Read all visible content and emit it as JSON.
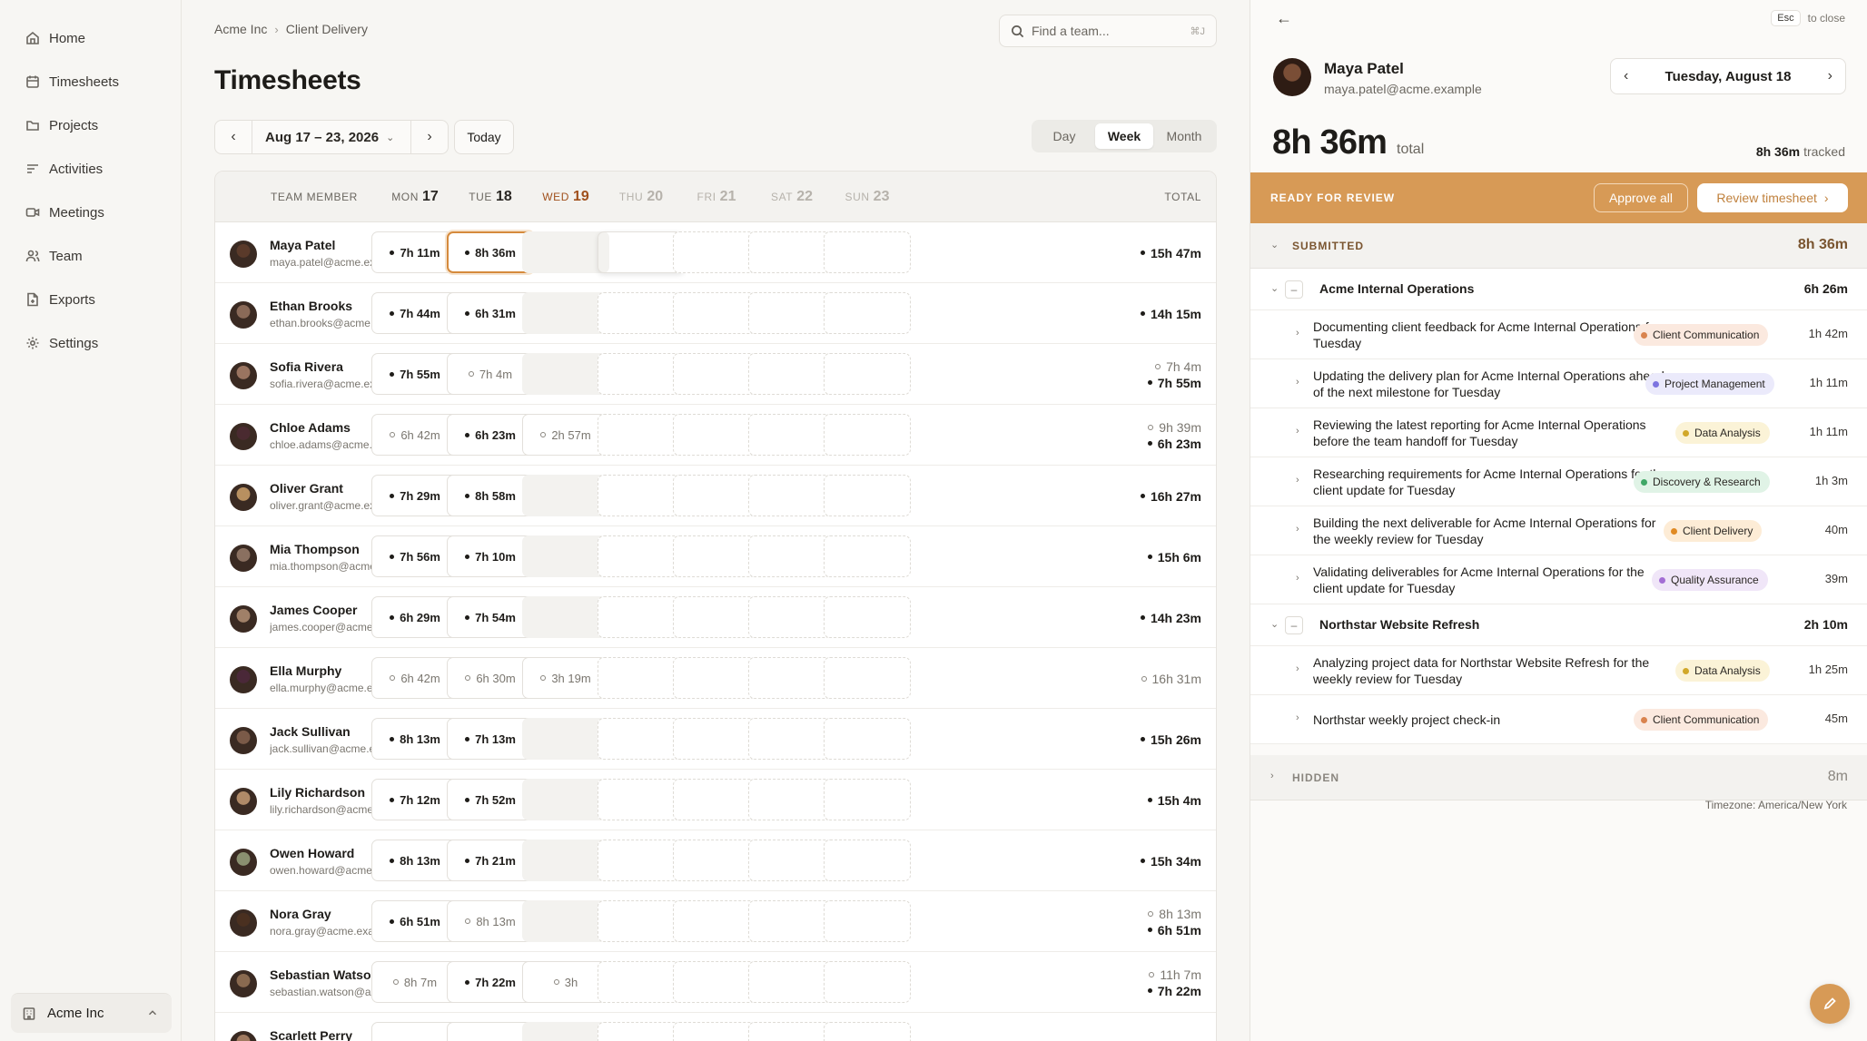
{
  "sidebar": {
    "items": [
      {
        "label": "Home",
        "icon": "home-icon"
      },
      {
        "label": "Timesheets",
        "icon": "calendar-icon"
      },
      {
        "label": "Projects",
        "icon": "folder-icon"
      },
      {
        "label": "Activities",
        "icon": "list-icon"
      },
      {
        "label": "Meetings",
        "icon": "video-icon"
      },
      {
        "label": "Team",
        "icon": "users-icon"
      },
      {
        "label": "Exports",
        "icon": "file-export-icon"
      },
      {
        "label": "Settings",
        "icon": "gear-icon"
      }
    ],
    "org": "Acme Inc"
  },
  "header": {
    "breadcrumb": [
      "Acme Inc",
      "Client Delivery"
    ],
    "search_placeholder": "Find a team...",
    "search_shortcut": "⌘J",
    "title": "Timesheets",
    "date_range": "Aug 17 – 23, 2026",
    "today": "Today",
    "views": [
      "Day",
      "Week",
      "Month"
    ],
    "active_view": "Week"
  },
  "table": {
    "member_header": "TEAM MEMBER",
    "total_header": "TOTAL",
    "days": [
      {
        "dow": "MON",
        "num": "17"
      },
      {
        "dow": "TUE",
        "num": "18"
      },
      {
        "dow": "WED",
        "num": "19"
      },
      {
        "dow": "THU",
        "num": "20"
      },
      {
        "dow": "FRI",
        "num": "21"
      },
      {
        "dow": "SAT",
        "num": "22"
      },
      {
        "dow": "SUN",
        "num": "23"
      }
    ],
    "rows": [
      {
        "name": "Maya Patel",
        "email": "maya.patel@acme.example",
        "avatar": "#5a3a2a",
        "mon": "7h 11m",
        "mon_s": "f",
        "tue": "8h 36m",
        "tue_s": "f",
        "wed": "",
        "wed_s": "blank",
        "total_pending": "",
        "total": "15h 47m"
      },
      {
        "name": "Ethan Brooks",
        "email": "ethan.brooks@acme.example",
        "avatar": "#8a6a58",
        "mon": "7h 44m",
        "mon_s": "f",
        "tue": "6h 31m",
        "tue_s": "f",
        "wed": "",
        "wed_s": "blank",
        "total_pending": "",
        "total": "14h 15m"
      },
      {
        "name": "Sofia Rivera",
        "email": "sofia.rivera@acme.example",
        "avatar": "#9a7460",
        "mon": "7h 55m",
        "mon_s": "f",
        "tue": "7h 4m",
        "tue_s": "p",
        "wed": "",
        "wed_s": "blank",
        "total_pending": "7h 4m",
        "total": "7h 55m"
      },
      {
        "name": "Chloe Adams",
        "email": "chloe.adams@acme.example",
        "avatar": "#4a2a30",
        "mon": "6h 42m",
        "mon_s": "p",
        "tue": "6h 23m",
        "tue_s": "f",
        "wed": "2h 57m",
        "wed_s": "p",
        "total_pending": "9h 39m",
        "total": "6h 23m"
      },
      {
        "name": "Oliver Grant",
        "email": "oliver.grant@acme.example",
        "avatar": "#b89060",
        "mon": "7h 29m",
        "mon_s": "f",
        "tue": "8h 58m",
        "tue_s": "f",
        "wed": "",
        "wed_s": "blank",
        "total_pending": "",
        "total": "16h 27m"
      },
      {
        "name": "Mia Thompson",
        "email": "mia.thompson@acme.example",
        "avatar": "#8a7060",
        "mon": "7h 56m",
        "mon_s": "f",
        "tue": "7h 10m",
        "tue_s": "f",
        "wed": "",
        "wed_s": "blank",
        "total_pending": "",
        "total": "15h 6m"
      },
      {
        "name": "James Cooper",
        "email": "james.cooper@acme.example",
        "avatar": "#a08068",
        "mon": "6h 29m",
        "mon_s": "f",
        "tue": "7h 54m",
        "tue_s": "f",
        "wed": "",
        "wed_s": "blank",
        "total_pending": "",
        "total": "14h 23m"
      },
      {
        "name": "Ella Murphy",
        "email": "ella.murphy@acme.example",
        "avatar": "#4a2838",
        "mon": "6h 42m",
        "mon_s": "p",
        "tue": "6h 30m",
        "tue_s": "p",
        "wed": "3h 19m",
        "wed_s": "p",
        "total_pending": "16h 31m",
        "total": ""
      },
      {
        "name": "Jack Sullivan",
        "email": "jack.sullivan@acme.example",
        "avatar": "#7a5a48",
        "mon": "8h 13m",
        "mon_s": "f",
        "tue": "7h 13m",
        "tue_s": "f",
        "wed": "",
        "wed_s": "blank",
        "total_pending": "",
        "total": "15h 26m"
      },
      {
        "name": "Lily Richardson",
        "email": "lily.richardson@acme.example",
        "avatar": "#b08a68",
        "mon": "7h 12m",
        "mon_s": "f",
        "tue": "7h 52m",
        "tue_s": "f",
        "wed": "",
        "wed_s": "blank",
        "total_pending": "",
        "total": "15h 4m"
      },
      {
        "name": "Owen Howard",
        "email": "owen.howard@acme.example",
        "avatar": "#8a9070",
        "mon": "8h 13m",
        "mon_s": "f",
        "tue": "7h 21m",
        "tue_s": "f",
        "wed": "",
        "wed_s": "blank",
        "total_pending": "",
        "total": "15h 34m"
      },
      {
        "name": "Nora Gray",
        "email": "nora.gray@acme.example",
        "avatar": "#4a3020",
        "mon": "6h 51m",
        "mon_s": "f",
        "tue": "8h 13m",
        "tue_s": "p",
        "wed": "",
        "wed_s": "blank",
        "total_pending": "8h 13m",
        "total": "6h 51m"
      },
      {
        "name": "Sebastian Watson",
        "email": "sebastian.watson@acme.example",
        "avatar": "#8a6a50",
        "mon": "8h 7m",
        "mon_s": "p",
        "tue": "7h 22m",
        "tue_s": "f",
        "wed": "3h",
        "wed_s": "p",
        "total_pending": "11h 7m",
        "total": "7h 22m"
      },
      {
        "name": "Scarlett Perry",
        "email": "",
        "avatar": "#a07a60",
        "mon": "",
        "mon_s": "f",
        "tue": "",
        "tue_s": "f",
        "wed": "",
        "wed_s": "blank",
        "total_pending": "",
        "total": ""
      }
    ]
  },
  "panel": {
    "esc": "Esc",
    "esc_hint": "to close",
    "name": "Maya Patel",
    "email": "maya.patel@acme.example",
    "day": "Tuesday, August 18",
    "total": "8h 36m",
    "total_label": "total",
    "tracked_value": "8h 36m",
    "tracked_label": "tracked",
    "ready_label": "READY FOR REVIEW",
    "approve_all": "Approve all",
    "review": "Review timesheet",
    "submitted_label": "SUBMITTED",
    "submitted_time": "8h 36m",
    "hidden_label": "HIDDEN",
    "hidden_time": "8m",
    "timezone": "Timezone: America/New York",
    "projects": [
      {
        "name": "Acme Internal Operations",
        "time": "6h 26m",
        "activities": [
          {
            "text": "Documenting client feedback for Acme Internal Operations for Tuesday",
            "tag": "Client Communication",
            "time": "1h 42m"
          },
          {
            "text": "Updating the delivery plan for Acme Internal Operations ahead of the next milestone for Tuesday",
            "tag": "Project Management",
            "time": "1h 11m"
          },
          {
            "text": "Reviewing the latest reporting for Acme Internal Operations before the team handoff for Tuesday",
            "tag": "Data Analysis",
            "time": "1h 11m"
          },
          {
            "text": "Researching requirements for Acme Internal Operations for the client update for Tuesday",
            "tag": "Discovery & Research",
            "time": "1h 3m"
          },
          {
            "text": "Building the next deliverable for Acme Internal Operations for the weekly review for Tuesday",
            "tag": "Client Delivery",
            "time": "40m"
          },
          {
            "text": "Validating deliverables for Acme Internal Operations for the client update for Tuesday",
            "tag": "Quality Assurance",
            "time": "39m"
          }
        ]
      },
      {
        "name": "Northstar Website Refresh",
        "time": "2h 10m",
        "activities": [
          {
            "text": "Analyzing project data for Northstar Website Refresh for the weekly review for Tuesday",
            "tag": "Data Analysis",
            "time": "1h 25m"
          },
          {
            "text": "Northstar weekly project check-in",
            "tag": "Client Communication",
            "time": "45m"
          }
        ]
      }
    ]
  },
  "colors": {
    "accent": "#d79a56",
    "tags": {
      "Client Communication": {
        "bg": "#fbe9df",
        "dot": "#d9834e"
      },
      "Project Management": {
        "bg": "#ebeafb",
        "dot": "#7d74e0"
      },
      "Data Analysis": {
        "bg": "#fbf3d7",
        "dot": "#d1a82a"
      },
      "Discovery & Research": {
        "bg": "#e0f3e6",
        "dot": "#3fa766"
      },
      "Client Delivery": {
        "bg": "#fdecd6",
        "dot": "#e08a24"
      },
      "Quality Assurance": {
        "bg": "#f0e6f8",
        "dot": "#a36dd4"
      }
    }
  }
}
